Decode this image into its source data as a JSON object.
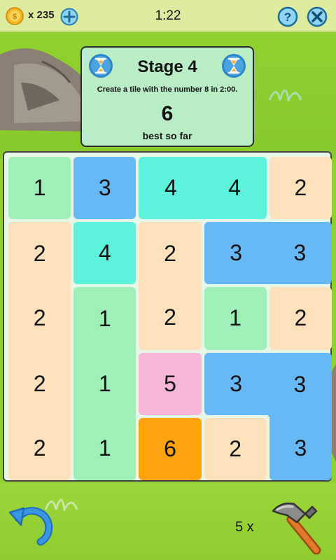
{
  "topbar": {
    "coins": "x 235",
    "timer": "1:22"
  },
  "stage": {
    "title": "Stage 4",
    "description": "Create a tile with the number 8 in 2:00.",
    "best_value": "6",
    "best_label": "best so far"
  },
  "board": {
    "cols": 5,
    "rows": 5,
    "colors": {
      "1": "#9ff0b8",
      "2": "#fde1bd",
      "3": "#66b9f5",
      "4": "#5cf2dc",
      "5": "#f7b6d8",
      "6": "#ffa20f"
    },
    "tiles": [
      {
        "row": 0,
        "col": 0,
        "value": "1"
      },
      {
        "row": 0,
        "col": 1,
        "value": "3"
      },
      {
        "row": 0,
        "col": 2,
        "value": "4"
      },
      {
        "row": 0,
        "col": 3,
        "value": "4"
      },
      {
        "row": 0,
        "col": 4,
        "value": "2"
      },
      {
        "row": 1,
        "col": 0,
        "value": "2"
      },
      {
        "row": 1,
        "col": 1,
        "value": "4"
      },
      {
        "row": 1,
        "col": 2,
        "value": "2"
      },
      {
        "row": 1,
        "col": 3,
        "value": "3"
      },
      {
        "row": 1,
        "col": 4,
        "value": "3"
      },
      {
        "row": 2,
        "col": 0,
        "value": "2"
      },
      {
        "row": 2,
        "col": 1,
        "value": "1"
      },
      {
        "row": 2,
        "col": 2,
        "value": "2"
      },
      {
        "row": 2,
        "col": 3,
        "value": "1"
      },
      {
        "row": 2,
        "col": 4,
        "value": "2"
      },
      {
        "row": 3,
        "col": 0,
        "value": "2"
      },
      {
        "row": 3,
        "col": 1,
        "value": "1"
      },
      {
        "row": 3,
        "col": 2,
        "value": "5"
      },
      {
        "row": 3,
        "col": 3,
        "value": "3"
      },
      {
        "row": 3,
        "col": 4,
        "value": "3"
      },
      {
        "row": 4,
        "col": 0,
        "value": "2"
      },
      {
        "row": 4,
        "col": 1,
        "value": "1"
      },
      {
        "row": 4,
        "col": 2,
        "value": "6"
      },
      {
        "row": 4,
        "col": 3,
        "value": "2"
      },
      {
        "row": 4,
        "col": 4,
        "value": "3"
      }
    ]
  },
  "bottombar": {
    "hammer_count": "5 x"
  },
  "icons": {
    "coin": "coin-icon",
    "add": "plus-icon",
    "help": "help-icon",
    "close": "close-icon",
    "timer": "hourglass-icon",
    "undo": "undo-icon",
    "hammer": "hammer-icon"
  }
}
